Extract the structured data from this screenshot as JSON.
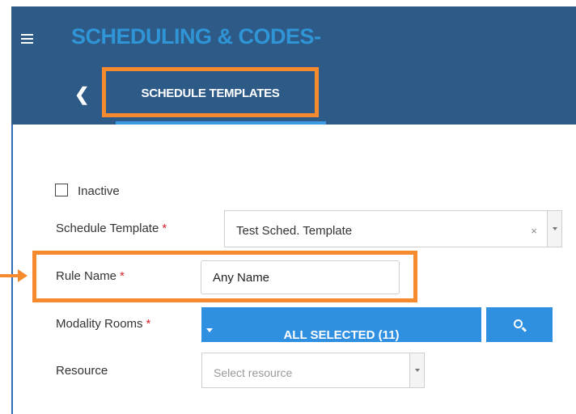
{
  "header": {
    "title": "SCHEDULING & CODES",
    "title_caret": "-",
    "back_label": "❮",
    "tab_label": "SCHEDULE TEMPLATES"
  },
  "form": {
    "inactive_label": "Inactive",
    "inactive_checked": false,
    "schedule_template_label": "Schedule Template",
    "schedule_template_value": "Test Sched. Template",
    "clear_symbol": "×",
    "rule_name_label": "Rule Name",
    "rule_name_value": "Any Name",
    "modality_rooms_label": "Modality Rooms",
    "modality_rooms_button": "ALL SELECTED (11)",
    "resource_label": "Resource",
    "resource_placeholder": "Select resource",
    "required_marker": "*"
  },
  "colors": {
    "header_bg": "#2d5a87",
    "title": "#2f95d6",
    "highlight": "#f58a2e",
    "button": "#2f8fe0",
    "required": "#d9232d"
  }
}
